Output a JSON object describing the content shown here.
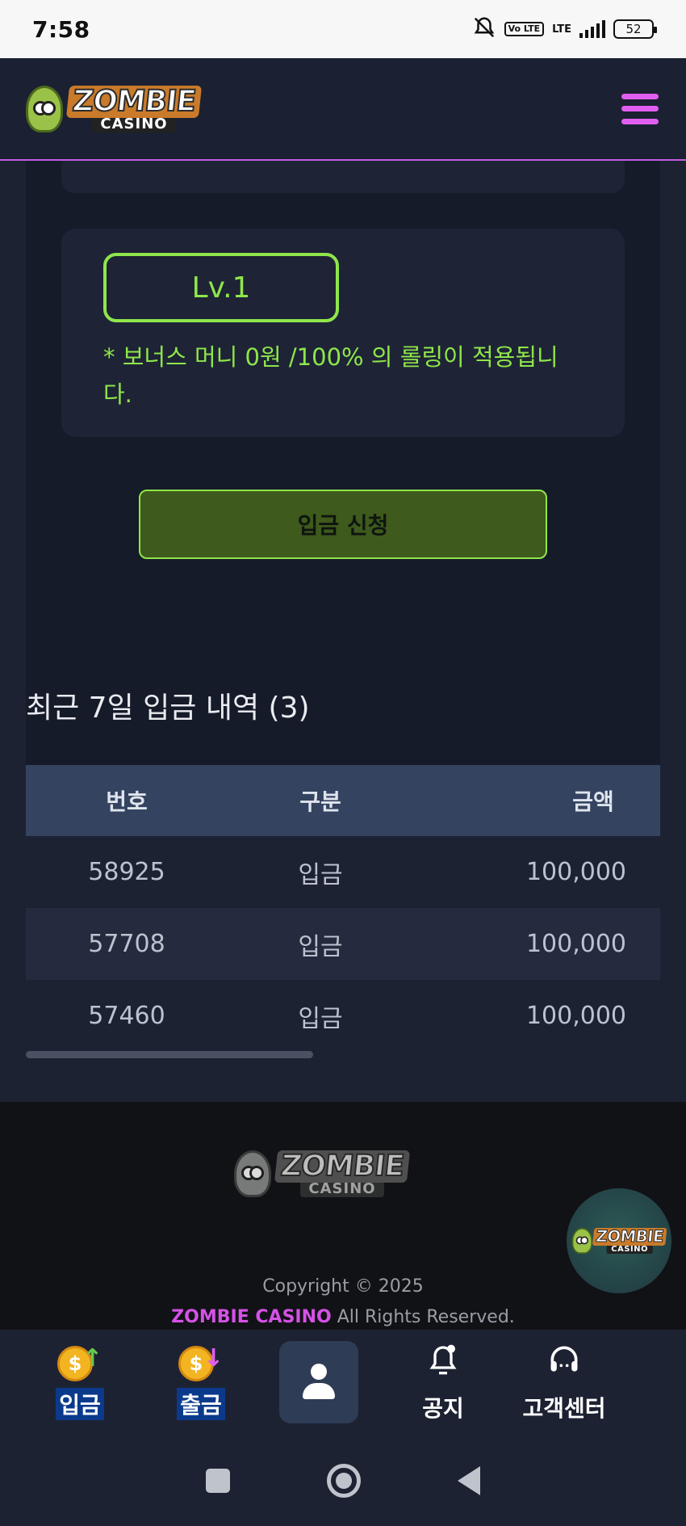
{
  "status_bar": {
    "time": "7:58",
    "volte_label": "Vo LTE",
    "network_label": "LTE",
    "battery": "52"
  },
  "header": {
    "logo_main": "ZOMBIE",
    "logo_sub": "CASINO",
    "menu_icon": "hamburger-menu-icon",
    "accent_color": "#e15ff0"
  },
  "bonus": {
    "level_label": "Lv.1",
    "note": "* 보너스 머니 0원 /100% 의 롤링이 적용됩니다.",
    "accent_color": "#8fe64a"
  },
  "deposit_button": "입금 신청",
  "history": {
    "title": "최근 7일 입금 내역 (3)",
    "columns": [
      "번호",
      "구분",
      "금액"
    ],
    "rows": [
      [
        "58925",
        "입금",
        "100,000"
      ],
      [
        "57708",
        "입금",
        "100,000"
      ],
      [
        "57460",
        "입금",
        "100,000"
      ]
    ]
  },
  "footer": {
    "logo_main": "ZOMBIE",
    "logo_sub": "CASINO",
    "copyright_line": "Copyright © 2025",
    "brand": "ZOMBIE CASINO",
    "rights": " All Rights Reserved."
  },
  "bottom_nav": {
    "deposit": "입금",
    "withdraw": "출금",
    "notice": "공지",
    "support": "고객센터",
    "coin_symbol": "$"
  }
}
